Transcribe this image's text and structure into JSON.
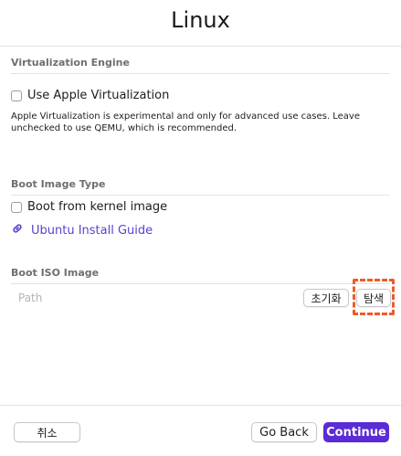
{
  "window": {
    "title": "Linux"
  },
  "virtualization": {
    "section_label": "Virtualization Engine",
    "checkbox_label": "Use Apple Virtualization",
    "checked": false,
    "description": "Apple Virtualization is experimental and only for advanced use cases. Leave unchecked to use QEMU, which is recommended."
  },
  "boot_image": {
    "section_label": "Boot Image Type",
    "checkbox_label": "Boot from kernel image",
    "checked": false,
    "link_label": "Ubuntu Install Guide",
    "link_icon": "link-icon"
  },
  "boot_iso": {
    "section_label": "Boot ISO Image",
    "path_placeholder": "Path",
    "reset_label": "초기화",
    "browse_label": "탐색"
  },
  "footer": {
    "cancel_label": "취소",
    "back_label": "Go Back",
    "continue_label": "Continue"
  },
  "colors": {
    "accent": "#5b2bd6",
    "link": "#5a3fd1",
    "highlight": "#f05a28"
  }
}
